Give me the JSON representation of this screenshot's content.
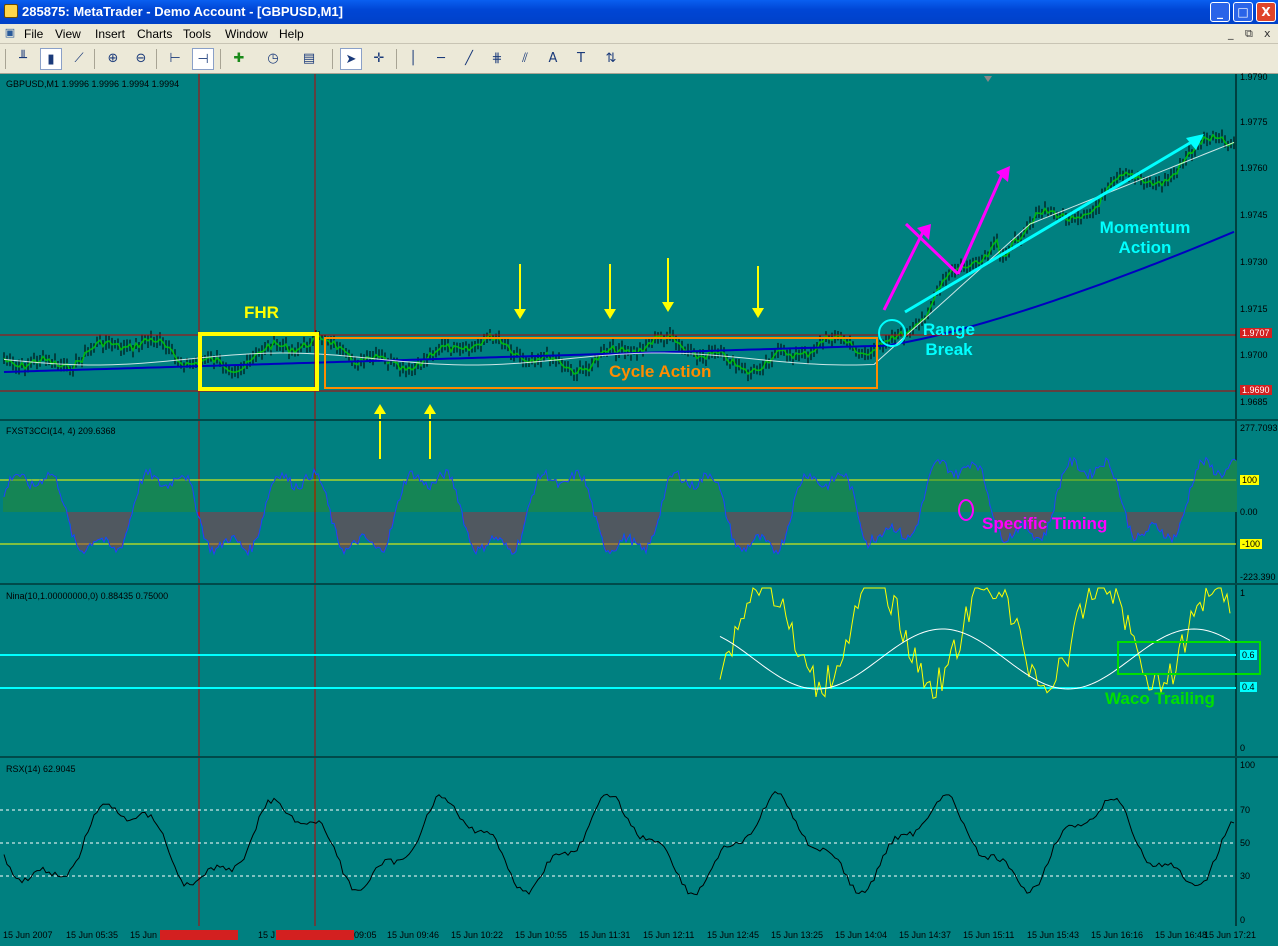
{
  "window": {
    "title": "285875: MetaTrader - Demo Account - [GBPUSD,M1]",
    "minimize": "_",
    "maximize": "□",
    "close": "X"
  },
  "menu": [
    "File",
    "View",
    "Insert",
    "Charts",
    "Tools",
    "Window",
    "Help"
  ],
  "mdi": {
    "minimize": "_",
    "restore": "⧉",
    "close": "x"
  },
  "toolbar": {
    "icons": [
      "bar-chart-icon",
      "candlestick-icon",
      "line-chart-icon",
      "zoom-in-icon",
      "zoom-out-icon",
      "chart-shift-icon",
      "autoscroll-icon",
      "add-indicator-icon",
      "periods-icon",
      "templates-icon",
      "cursor-icon",
      "crosshair-icon",
      "vertical-line-icon",
      "horizontal-line-icon",
      "trendline-icon",
      "fibonacci-icon",
      "text-icon",
      "text-label-icon",
      "arrows-icon"
    ],
    "glyphs": {
      "text": "A",
      "text_label": "T"
    }
  },
  "panels": {
    "price": {
      "label": "GBPUSD,M1  1.9996 1.9996 1.9994 1.9994",
      "ticks": [
        "1.9790",
        "1.9775",
        "1.9760",
        "1.9745",
        "1.9730",
        "1.9715",
        "1.9700",
        "1.9685"
      ],
      "tags": {
        "upper": "1.9707",
        "lower": "1.9690"
      }
    },
    "cci": {
      "label": "FXST3CCI(14, 4) 209.6368",
      "ticks": [
        "277.7093",
        "100",
        "0.00",
        "-100",
        "-223.390"
      ]
    },
    "nina": {
      "label": "Nina(10,1.00000000,0) 0.88435 0.75000",
      "ticks": [
        "1",
        "0.6",
        "0.4",
        "0"
      ]
    },
    "rsx": {
      "label": "RSX(14) 62.9045",
      "ticks": [
        "100",
        "70",
        "50",
        "30",
        "0"
      ]
    }
  },
  "time_axis": [
    "15 Jun 2007",
    "15 Jun 05:35",
    "15 Jun",
    "",
    "15 J",
    "",
    "09:05",
    "15 Jun 09:46",
    "15 Jun 10:22",
    "15 Jun 10:55",
    "15 Jun 11:31",
    "15 Jun 12:11",
    "15 Jun 12:45",
    "15 Jun 13:25",
    "15 Jun 14:04",
    "15 Jun 14:37",
    "15 Jun 15:11",
    "15 Jun 15:43",
    "15 Jun 16:16",
    "15 Jun 16:48",
    "15 Jun 17:21"
  ],
  "annotations": {
    "fhr": "FHR",
    "cycle": "Cycle Action",
    "range": "Range\nBreak",
    "momentum": "Momentum\nAction",
    "timing": "Specific Timing",
    "waco": "Waco Trailing"
  },
  "colors": {
    "background": "#008080",
    "highlight_yellow": "#ffff00",
    "orange": "#ff8c00",
    "cyan": "#00ffff",
    "magenta": "#ff00ff",
    "green": "#00ff00",
    "blue_ma": "#0000c0",
    "vline_red": "#c00000"
  }
}
